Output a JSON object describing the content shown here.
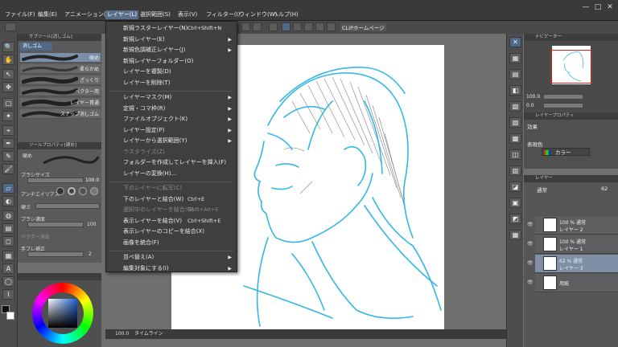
{
  "menubar": {
    "items": [
      "ファイル(F)",
      "編集(E)",
      "アニメーション(A)",
      "レイヤー(L)",
      "選択範囲(S)",
      "表示(V)",
      "フィルター(I)",
      "ウィンドウ(W)",
      "ヘルプ(H)"
    ],
    "active_index": 3,
    "window_controls": [
      "—",
      "□",
      "✕"
    ]
  },
  "toolbar": {
    "clip_button": "CLIPホームページ"
  },
  "subtool_panel": {
    "title": "サブツール[消しゴム]",
    "active_tab": "消しゴム",
    "brushes": [
      "硬め",
      "柔らかめ",
      "ざっくり",
      "ベクター用",
      "レイヤー貫通",
      "スナップ消しゴム"
    ]
  },
  "tool_property": {
    "title": "ツールプロパティ[硬め]",
    "brush_label": "硬め",
    "brush_size_label": "ブラシサイズ",
    "brush_size_value": "100.0",
    "antialias_label": "アンチエイリアス",
    "hardness_label": "硬さ",
    "density_label": "ブラシ濃度",
    "density_value": "100",
    "vector_label": "ベクター消去",
    "stabilization_label": "手ブレ補正",
    "stabilization_value": "2"
  },
  "layer_menu": {
    "items": [
      {
        "label": "新規ラスターレイヤー(N)",
        "shortcut": "Ctrl+Shift+N",
        "arrow": false,
        "disabled": false
      },
      {
        "label": "新規レイヤー(E)",
        "shortcut": "",
        "arrow": true,
        "disabled": false
      },
      {
        "label": "新規色調補正レイヤー(J)",
        "shortcut": "",
        "arrow": true,
        "disabled": false
      },
      {
        "label": "新規レイヤーフォルダー(O)",
        "shortcut": "",
        "arrow": false,
        "disabled": false
      },
      {
        "label": "レイヤーを複製(D)",
        "shortcut": "",
        "arrow": false,
        "disabled": false
      },
      {
        "label": "レイヤーを削除(T)",
        "shortcut": "",
        "arrow": false,
        "disabled": false
      },
      {
        "sep": true
      },
      {
        "label": "レイヤーマスク(M)",
        "shortcut": "",
        "arrow": true,
        "disabled": false
      },
      {
        "label": "定規・コマ枠(R)",
        "shortcut": "",
        "arrow": true,
        "disabled": false
      },
      {
        "label": "ファイルオブジェクト(K)",
        "shortcut": "",
        "arrow": true,
        "disabled": false
      },
      {
        "label": "レイヤー設定(P)",
        "shortcut": "",
        "arrow": true,
        "disabled": false
      },
      {
        "label": "レイヤーから選択範囲(Y)",
        "shortcut": "",
        "arrow": true,
        "disabled": false
      },
      {
        "label": "ラスタライズ(Z)",
        "shortcut": "",
        "arrow": false,
        "disabled": true
      },
      {
        "label": "フォルダーを作成してレイヤーを挿入(F)",
        "shortcut": "",
        "arrow": false,
        "disabled": false
      },
      {
        "label": "レイヤーの変換(H)...",
        "shortcut": "",
        "arrow": false,
        "disabled": false
      },
      {
        "sep": true
      },
      {
        "label": "下のレイヤーに転写(C)",
        "shortcut": "",
        "arrow": false,
        "disabled": true
      },
      {
        "label": "下のレイヤーと結合(W)",
        "shortcut": "Ctrl+E",
        "arrow": false,
        "disabled": false
      },
      {
        "label": "選択中のレイヤーを結合(G)",
        "shortcut": "Shift+Alt+E",
        "arrow": false,
        "disabled": true
      },
      {
        "label": "表示レイヤーを結合(V)",
        "shortcut": "Ctrl+Shift+E",
        "arrow": false,
        "disabled": false
      },
      {
        "label": "表示レイヤーのコピーを結合(X)",
        "shortcut": "",
        "arrow": false,
        "disabled": false
      },
      {
        "label": "画像を統合(F)",
        "shortcut": "",
        "arrow": false,
        "disabled": false
      },
      {
        "sep": true
      },
      {
        "label": "並べ替え(A)",
        "shortcut": "",
        "arrow": true,
        "disabled": false
      },
      {
        "label": "編集対象にする(I)",
        "shortcut": "",
        "arrow": true,
        "disabled": false
      }
    ]
  },
  "navigator": {
    "title": "ナビゲーター",
    "zoom": "100.0",
    "angle": "0.0"
  },
  "layer_property": {
    "title": "レイヤープロパティ",
    "effect_label": "効果",
    "display_color_label": "表現色",
    "display_color_value": "カラー"
  },
  "layers_panel": {
    "title": "レイヤー",
    "blend_mode": "通常",
    "opacity": "62",
    "layers": [
      {
        "line1": "100 % 通常",
        "line2": "レイヤー 2",
        "selected": false
      },
      {
        "line1": "100 % 通常",
        "line2": "レイヤー 1",
        "selected": false
      },
      {
        "line1": "62 % 通常",
        "line2": "レイヤー 3",
        "selected": true
      },
      {
        "line1": "",
        "line2": "用紙",
        "selected": false
      }
    ]
  },
  "statusbar": {
    "zoom": "100.0",
    "timeline_tab": "タイムライン"
  },
  "colors": {
    "sketch_blue": "#33b8e6",
    "menu_bg": "#3f3f3f",
    "active_menu": "#5a6f8c",
    "selected_layer": "#7f8fa5"
  }
}
